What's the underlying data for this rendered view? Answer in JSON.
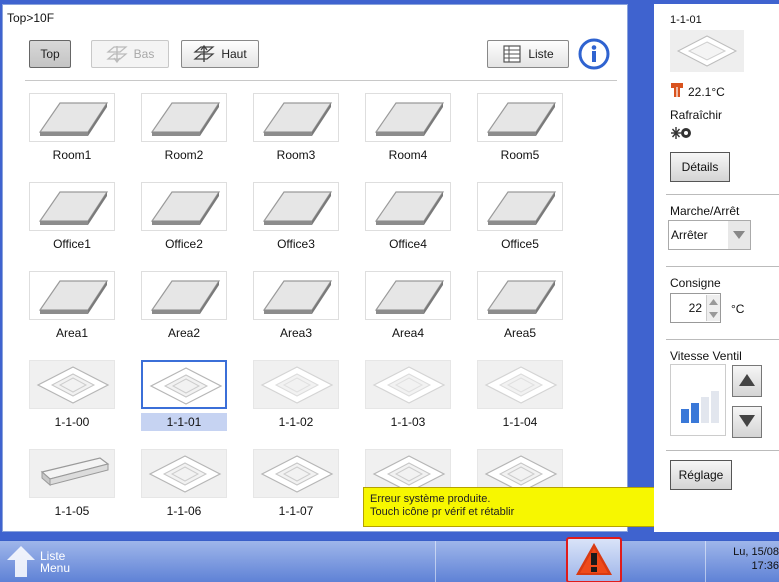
{
  "breadcrumb": "Top>10F",
  "toolbar": {
    "top_label": "Top",
    "bas_label": "Bas",
    "haut_label": "Haut",
    "liste_label": "Liste"
  },
  "tiles": [
    {
      "label": "Room1",
      "kind": "floor"
    },
    {
      "label": "Room2",
      "kind": "floor"
    },
    {
      "label": "Room3",
      "kind": "floor"
    },
    {
      "label": "Room4",
      "kind": "floor"
    },
    {
      "label": "Room5",
      "kind": "floor"
    },
    {
      "label": "Office1",
      "kind": "floor"
    },
    {
      "label": "Office2",
      "kind": "floor"
    },
    {
      "label": "Office3",
      "kind": "floor"
    },
    {
      "label": "Office4",
      "kind": "floor"
    },
    {
      "label": "Office5",
      "kind": "floor"
    },
    {
      "label": "Area1",
      "kind": "floor"
    },
    {
      "label": "Area2",
      "kind": "floor"
    },
    {
      "label": "Area3",
      "kind": "floor"
    },
    {
      "label": "Area4",
      "kind": "floor"
    },
    {
      "label": "Area5",
      "kind": "floor"
    },
    {
      "label": "1-1-00",
      "kind": "cassette"
    },
    {
      "label": "1-1-01",
      "kind": "cassette",
      "selected": true
    },
    {
      "label": "1-1-02",
      "kind": "cassette",
      "faded": true
    },
    {
      "label": "1-1-03",
      "kind": "cassette",
      "faded": true
    },
    {
      "label": "1-1-04",
      "kind": "cassette",
      "faded": true
    },
    {
      "label": "1-1-05",
      "kind": "ceiling"
    },
    {
      "label": "1-1-06",
      "kind": "cassette"
    },
    {
      "label": "1-1-07",
      "kind": "cassette"
    },
    {
      "label": "",
      "kind": "cassette"
    },
    {
      "label": "",
      "kind": "cassette"
    }
  ],
  "side": {
    "unit_name": "1-1-01",
    "temperature": "22.1°C",
    "mode": "Rafraîchir",
    "details_label": "Détails",
    "onoff_title": "Marche/Arrêt",
    "onoff_value": "Arrêter",
    "setpoint_title": "Consigne",
    "setpoint_value": "22",
    "setpoint_unit": "°C",
    "fan_title": "Vitesse Ventil",
    "fan_level_fraction": 0.5,
    "setting_label": "Réglage"
  },
  "toast": {
    "line1": "Erreur système produite.",
    "line2": "Touch icône pr vérif et rétablir",
    "close_glyph": "×"
  },
  "taskbar": {
    "menu_line1": "Liste",
    "menu_line2": "Menu",
    "date": "Lu, 15/08",
    "time": "17:36"
  },
  "colors": {
    "frame_blue": "#3f63cf",
    "selection_blue": "#3b6fd8",
    "toast_yellow": "#f7f700",
    "alarm_red": "#e01b1b",
    "thermo_orange": "#d9531e"
  },
  "icons": {
    "info": "info-icon",
    "liste": "list-icon",
    "bas": "floor-down-icon",
    "haut": "floor-up-icon",
    "alarm": "warning-icon",
    "menu": "up-arrow-icon",
    "mode": "cooling-mode-icon",
    "temperature": "thermometer-icon"
  }
}
